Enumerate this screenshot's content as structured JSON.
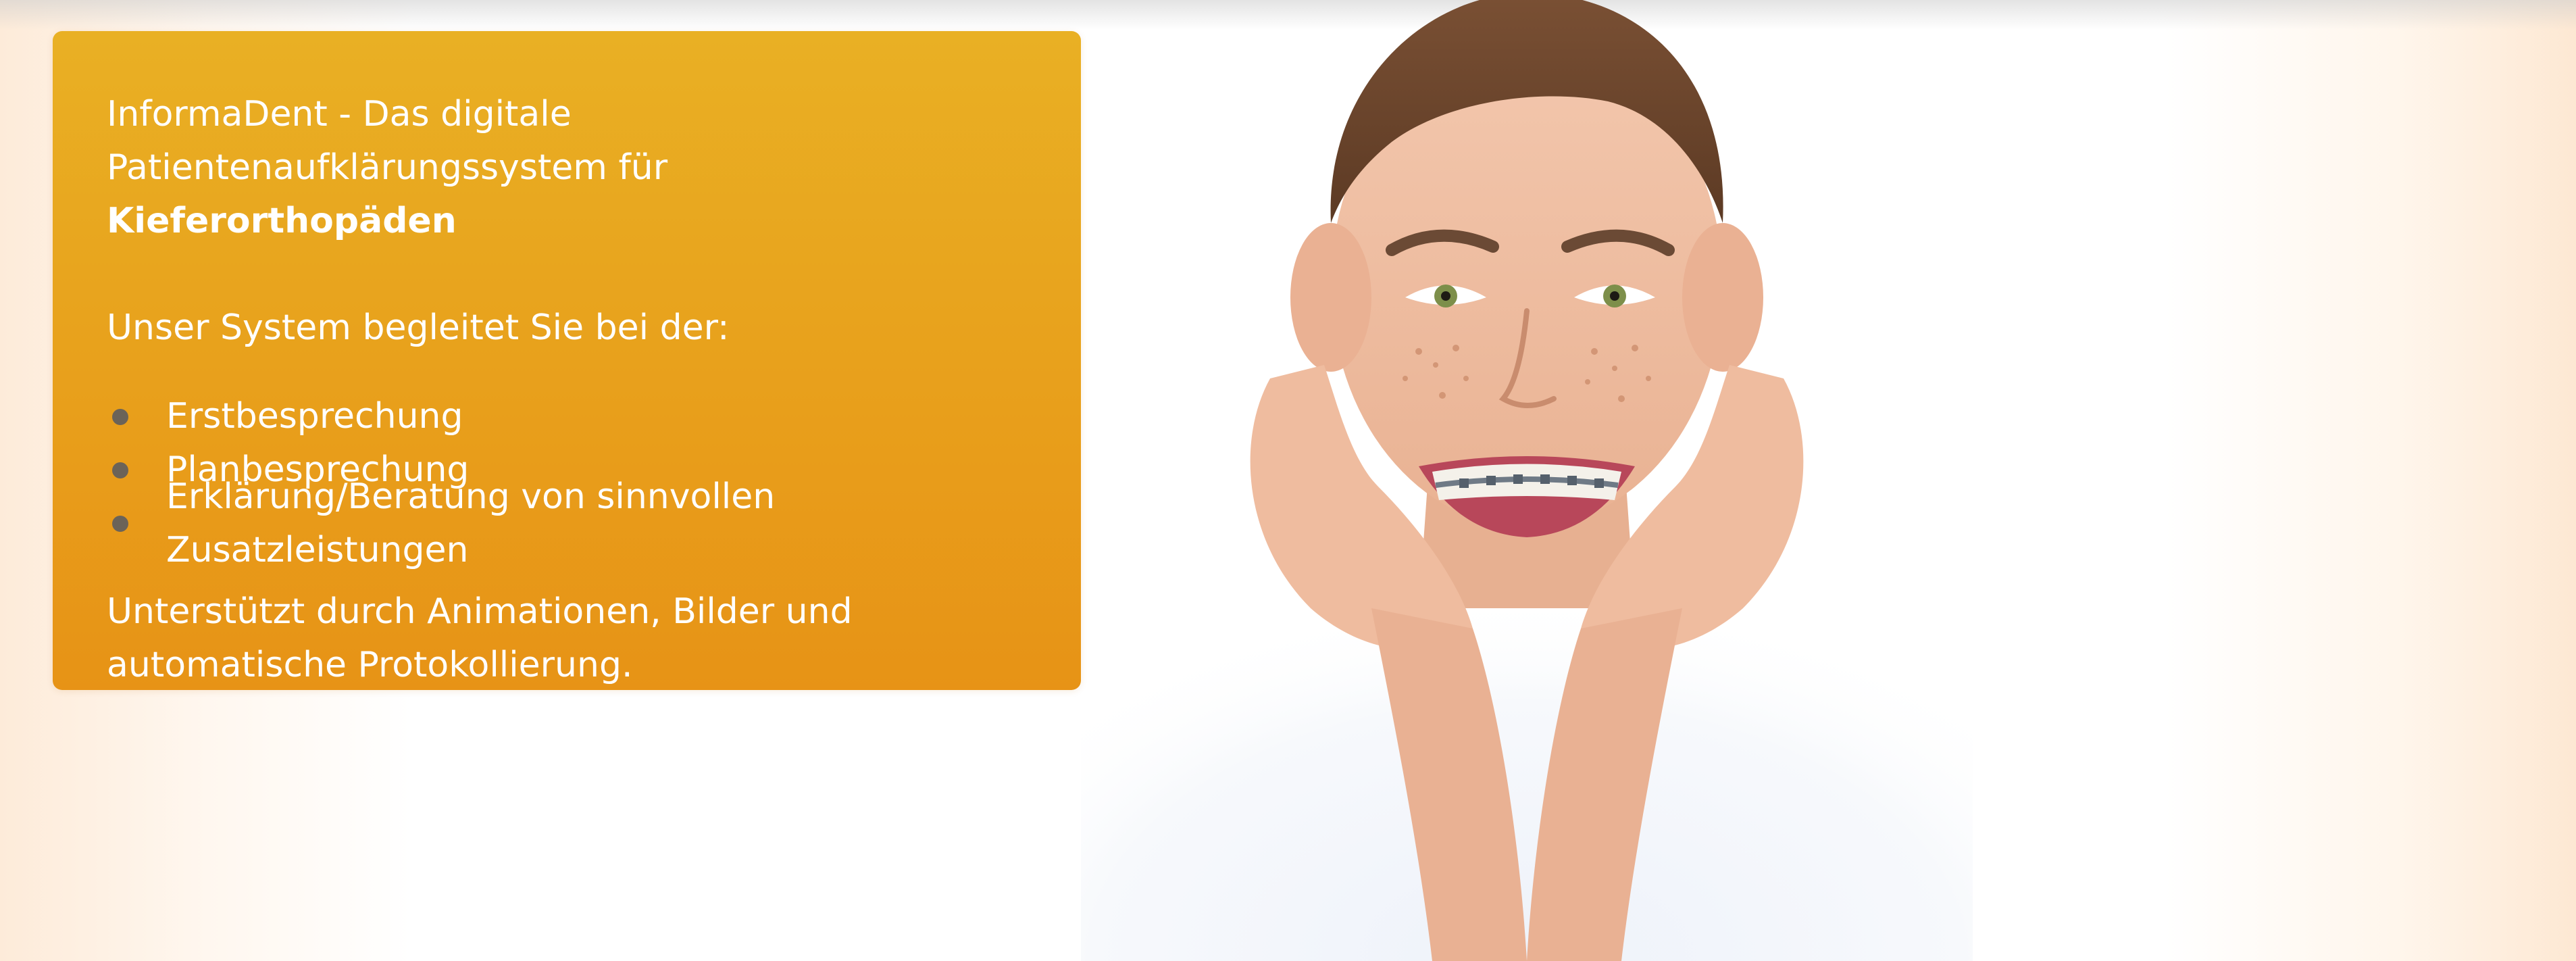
{
  "intro": {
    "line1": "InformaDent - Das digitale",
    "line2_prefix": "Patientenaufklärungssystem für ",
    "line2_bold": "Kieferorthopäden"
  },
  "lead": "Unser System begleitet Sie bei der:",
  "features": [
    "Erstbesprechung",
    "Planbesprechung",
    "Erklärung/Beratung von sinnvollen Zusatzleistungen"
  ],
  "outro": {
    "line1": "Unterstützt durch Animationen, Bilder und",
    "line2": "automatische Protokollierung."
  },
  "colors": {
    "card_top": "#e9b024",
    "card_bottom": "#e79316",
    "text": "#ffffff",
    "bullet": "#6b6358"
  },
  "image": {
    "subject": "smiling boy with braces resting chin on hands"
  }
}
